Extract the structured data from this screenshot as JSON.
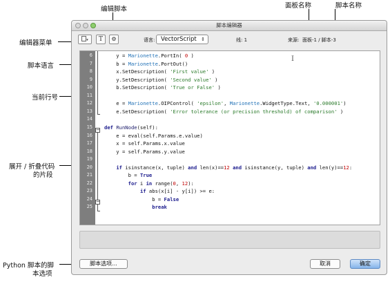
{
  "callouts": {
    "edit_script": "编辑脚本",
    "palette_name": "面板名称",
    "script_name": "脚本名称",
    "editor_menu": "编辑器菜单",
    "script_language": "脚本语言",
    "current_line": "当前行号",
    "fold_line1": "展开 / 折叠代码",
    "fold_line2": "的片段",
    "python_line1": "Python 脚本的脚",
    "python_line2": "本选项"
  },
  "window": {
    "title": "脚本编辑器",
    "language_label": "语言:",
    "language_value": "VectorScript",
    "line_label": "线: 1",
    "source_label": "来源:",
    "source_value": "面板-1 / 脚本-3",
    "tool_t": "T",
    "script_options_button": "脚本选项...",
    "cancel_button": "取消",
    "ok_button": "确定",
    "colors": {
      "gutter": "#7e7e7e",
      "keyword": "#1a1a8c",
      "string": "#2a7a2a",
      "number": "#c00000",
      "primary_button": "#86b4ea"
    }
  },
  "code": {
    "line_numbers": [
      "6",
      "7",
      "8",
      "9",
      "10",
      "11",
      "12",
      "13",
      "14",
      "15",
      "16",
      "17",
      "18",
      "19",
      "20",
      "21",
      "22",
      "23",
      "24",
      "25"
    ],
    "lines": [
      [
        {
          "t": "    y = ",
          "c": "plain"
        },
        {
          "t": "Marionette",
          "c": "obj"
        },
        {
          "t": ".PortIn( ",
          "c": "plain"
        },
        {
          "t": "0",
          "c": "num"
        },
        {
          "t": " )",
          "c": "plain"
        }
      ],
      [
        {
          "t": "    b = ",
          "c": "plain"
        },
        {
          "t": "Marionette",
          "c": "obj"
        },
        {
          "t": ".PortOut()",
          "c": "plain"
        }
      ],
      [
        {
          "t": "    x.SetDescription( ",
          "c": "plain"
        },
        {
          "t": "'First value'",
          "c": "str"
        },
        {
          "t": " )",
          "c": "plain"
        }
      ],
      [
        {
          "t": "    y.SetDescription( ",
          "c": "plain"
        },
        {
          "t": "'Second value'",
          "c": "str"
        },
        {
          "t": " )",
          "c": "plain"
        }
      ],
      [
        {
          "t": "    b.SetDescription( ",
          "c": "plain"
        },
        {
          "t": "'True or False'",
          "c": "str"
        },
        {
          "t": " )",
          "c": "plain"
        }
      ],
      [
        {
          "t": "",
          "c": "plain"
        }
      ],
      [
        {
          "t": "    e = ",
          "c": "plain"
        },
        {
          "t": "Marionette",
          "c": "obj"
        },
        {
          "t": ".OIPControl( ",
          "c": "plain"
        },
        {
          "t": "'epsilon'",
          "c": "str"
        },
        {
          "t": ", ",
          "c": "plain"
        },
        {
          "t": "Marionette",
          "c": "obj"
        },
        {
          "t": ".WidgetType.Text, ",
          "c": "plain"
        },
        {
          "t": "'0.000001'",
          "c": "str"
        },
        {
          "t": ")",
          "c": "plain"
        }
      ],
      [
        {
          "t": "    e.SetDescription( ",
          "c": "plain"
        },
        {
          "t": "'Error tolerance (or precision threshold) of comparison'",
          "c": "str"
        },
        {
          "t": " )",
          "c": "plain"
        }
      ],
      [
        {
          "t": "",
          "c": "plain"
        }
      ],
      [
        {
          "t": "def ",
          "c": "kw"
        },
        {
          "t": "RunNode",
          "c": "fn"
        },
        {
          "t": "(self):",
          "c": "plain"
        }
      ],
      [
        {
          "t": "    e = eval(self.Params.e.value)",
          "c": "plain"
        }
      ],
      [
        {
          "t": "    x = self.Params.x.value",
          "c": "plain"
        }
      ],
      [
        {
          "t": "    y = self.Params.y.value",
          "c": "plain"
        }
      ],
      [
        {
          "t": "",
          "c": "plain"
        }
      ],
      [
        {
          "t": "    ",
          "c": "plain"
        },
        {
          "t": "if",
          "c": "kw"
        },
        {
          "t": " isinstance(x, tuple) ",
          "c": "plain"
        },
        {
          "t": "and",
          "c": "kw"
        },
        {
          "t": " len(x)==",
          "c": "plain"
        },
        {
          "t": "12",
          "c": "num"
        },
        {
          "t": " ",
          "c": "plain"
        },
        {
          "t": "and",
          "c": "kw"
        },
        {
          "t": " isinstance(y, tuple) ",
          "c": "plain"
        },
        {
          "t": "and",
          "c": "kw"
        },
        {
          "t": " len(y)==",
          "c": "plain"
        },
        {
          "t": "12",
          "c": "num"
        },
        {
          "t": ":",
          "c": "plain"
        }
      ],
      [
        {
          "t": "        b = ",
          "c": "plain"
        },
        {
          "t": "True",
          "c": "kw"
        }
      ],
      [
        {
          "t": "        ",
          "c": "plain"
        },
        {
          "t": "for",
          "c": "kw"
        },
        {
          "t": " i ",
          "c": "plain"
        },
        {
          "t": "in",
          "c": "kw"
        },
        {
          "t": " range(",
          "c": "plain"
        },
        {
          "t": "0",
          "c": "num"
        },
        {
          "t": ", ",
          "c": "plain"
        },
        {
          "t": "12",
          "c": "num"
        },
        {
          "t": "):",
          "c": "plain"
        }
      ],
      [
        {
          "t": "            ",
          "c": "plain"
        },
        {
          "t": "if",
          "c": "kw"
        },
        {
          "t": " abs(x[i] - y[i]) >= e:",
          "c": "plain"
        }
      ],
      [
        {
          "t": "                b = ",
          "c": "plain"
        },
        {
          "t": "False",
          "c": "kw"
        }
      ],
      [
        {
          "t": "                ",
          "c": "plain"
        },
        {
          "t": "break",
          "c": "kw"
        }
      ]
    ]
  }
}
